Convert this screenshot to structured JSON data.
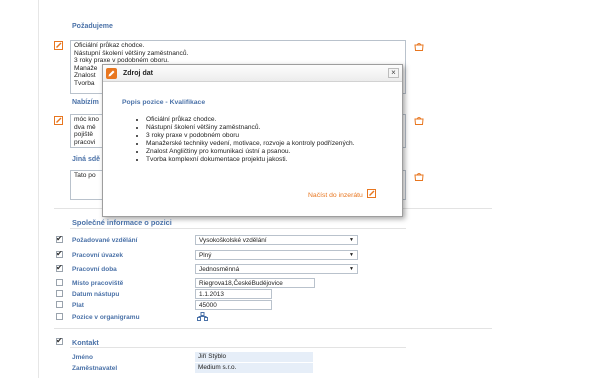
{
  "requirements": {
    "title": "Požadujeme",
    "text": "Oficiální průkaz chodce.\nNástupní školení většiny zaměstnanců.\n3 roky praxe v podobném oboru.\nManaže\nZnalost\nTvorba"
  },
  "offer": {
    "title": "Nabízím",
    "text": "móc kno\ndva mě\npojiště\npracovi"
  },
  "other": {
    "title": "Jiná sdě",
    "text": "Tato po"
  },
  "dialog": {
    "title": "Zdroj dat",
    "close_glyph": "×",
    "section_title": "Popis pozice - Kvalifikace",
    "items": [
      "Oficiální průkaz chodce.",
      "Nástupní školení většiny zaměstnanců.",
      "3 roky praxe v podobném oboru",
      "Manažerské techniky vedení, motivace, rozvoje a kontroly podřízených.",
      "Znalost Angličtiny pro komunikaci ústní a psanou.",
      "Tvorba komplexní dokumentace projektu jakosti."
    ],
    "load_label": "Načíst do inzerátu"
  },
  "common": {
    "title": "Společné informace o pozici",
    "fields": [
      {
        "label": "Požadované vzdělání",
        "value": "Vysokoškolské vzdělání",
        "checked": true
      },
      {
        "label": "Pracovní úvazek",
        "value": "Plný",
        "checked": true
      },
      {
        "label": "Pracovní doba",
        "value": "Jednosměnná",
        "checked": true
      },
      {
        "label": "Místo pracoviště",
        "value": "Riegrova18,ČeskéBudějovice",
        "checked": false
      },
      {
        "label": "Datum nástupu",
        "value": "1.1.2013",
        "checked": false
      },
      {
        "label": "Plat",
        "value": "45000",
        "checked": false
      },
      {
        "label": "Pozice v organigramu",
        "value": "",
        "checked": false
      }
    ]
  },
  "contact": {
    "title": "Kontakt",
    "checked": true,
    "name_label": "Jméno",
    "name_value": "Jiří Stýblo",
    "employer_label": "Zaměstnavatel",
    "employer_value": "Medium s.r.o."
  },
  "colors": {
    "accent_blue": "#4b72a8",
    "accent_orange": "#e8761f",
    "readonly_bg": "#e6eef8"
  }
}
